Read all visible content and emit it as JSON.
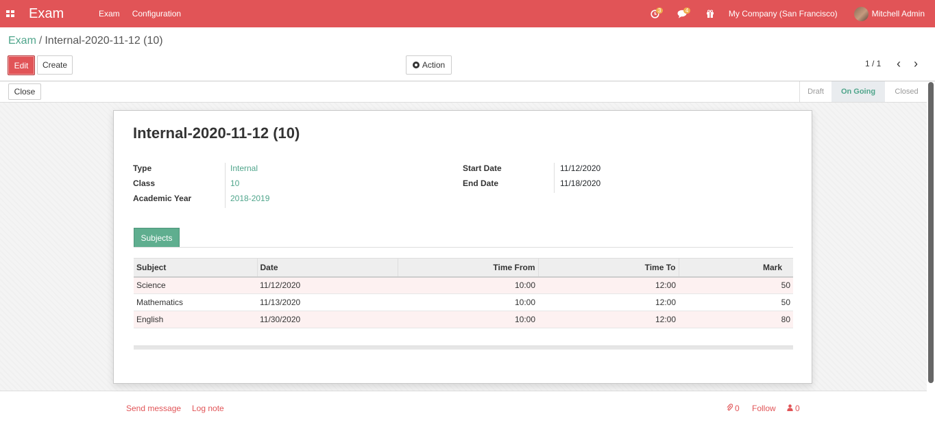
{
  "navbar": {
    "brand": "Exam",
    "menus": [
      "Exam",
      "Configuration"
    ],
    "activity_count": "3",
    "message_count": "4",
    "company": "My Company (San Francisco)",
    "user": "Mitchell Admin"
  },
  "breadcrumb": {
    "parent": "Exam",
    "separator": "/",
    "current": "Internal-2020-11-12 (10)"
  },
  "control": {
    "edit_label": "Edit",
    "create_label": "Create",
    "action_label": "Action",
    "pager": "1 / 1",
    "prev_icon": "‹",
    "next_icon": "›"
  },
  "statusbar": {
    "close_label": "Close",
    "stages": [
      "Draft",
      "On Going",
      "Closed"
    ],
    "active_stage": "On Going"
  },
  "record": {
    "title": "Internal-2020-11-12 (10)",
    "fields_left": [
      {
        "label": "Type",
        "value": "Internal"
      },
      {
        "label": "Class",
        "value": "10"
      },
      {
        "label": "Academic Year",
        "value": "2018-2019"
      }
    ],
    "fields_right": [
      {
        "label": "Start Date",
        "value": "11/12/2020"
      },
      {
        "label": "End Date",
        "value": "11/18/2020"
      }
    ],
    "tab": "Subjects",
    "table": {
      "headers": [
        "Subject",
        "Date",
        "Time From",
        "Time To",
        "Mark"
      ],
      "rows": [
        [
          "Science",
          "11/12/2020",
          "10:00",
          "12:00",
          "50"
        ],
        [
          "Mathematics",
          "11/13/2020",
          "10:00",
          "12:00",
          "50"
        ],
        [
          "English",
          "11/30/2020",
          "10:00",
          "12:00",
          "80"
        ]
      ]
    }
  },
  "chatter": {
    "send_message": "Send message",
    "log_note": "Log note",
    "attachments": "0",
    "follow": "Follow",
    "followers": "0"
  },
  "colors": {
    "brand": "#e15457",
    "accent": "#4fa58b",
    "badge": "#f0ad4e"
  }
}
